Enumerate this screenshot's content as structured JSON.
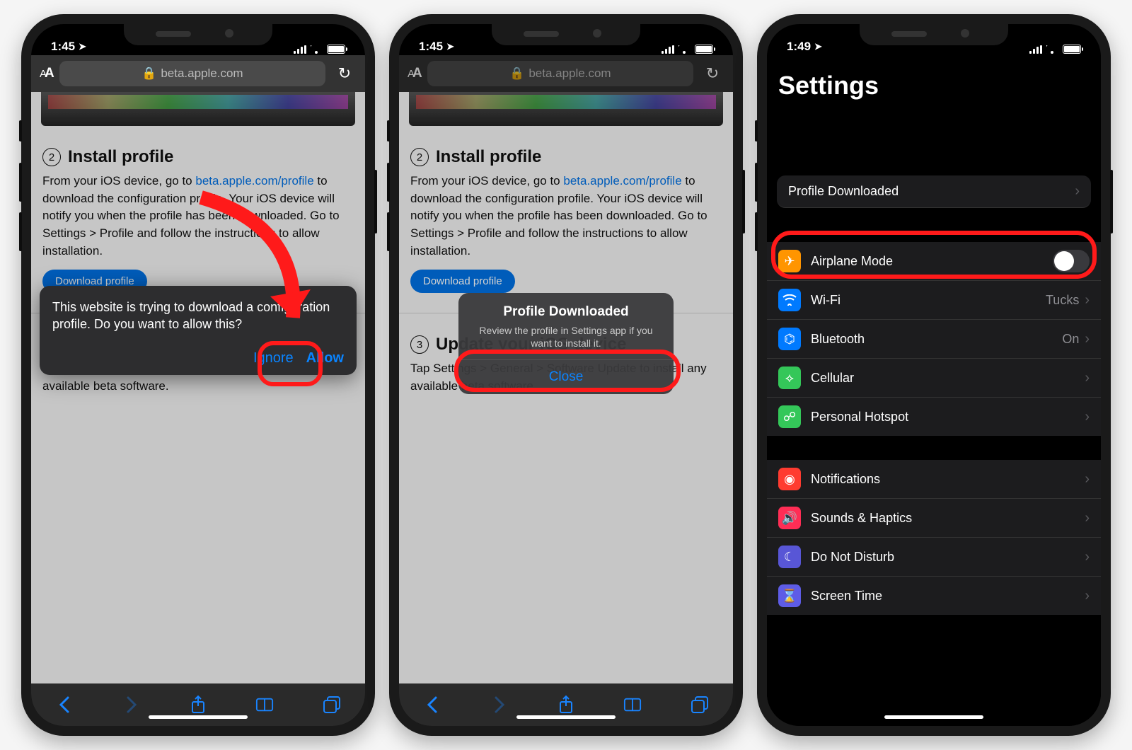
{
  "status": {
    "time12": "1:45",
    "time3": "1:49"
  },
  "safari": {
    "url_host": "beta.apple.com",
    "aa_small": "A",
    "aa_big": "A"
  },
  "page": {
    "step2_num": "2",
    "step2_title": "Install profile",
    "step2_body_pre": "From your iOS device, go to ",
    "step2_link_text": "beta.apple.com/profile",
    "step2_body_post": " to download the configuration profile. Your iOS device will notify you when the profile has been downloaded. Go to Settings > Profile and follow the instructions to allow installation.",
    "dl_btn": "Download profile",
    "step3_num": "3",
    "step3_title": "Update your iOS device",
    "step3_body": "Tap Settings > General > Software Update to install any available beta software."
  },
  "sheet": {
    "msg": "This website is trying to download a configuration profile. Do you want to allow this?",
    "ignore": "Ignore",
    "allow": "Allow"
  },
  "alert": {
    "title": "Profile Downloaded",
    "msg": "Review the profile in Settings app if you want to install it.",
    "close": "Close"
  },
  "settings": {
    "title": "Settings",
    "profile_row": "Profile Downloaded",
    "rows": {
      "airplane": "Airplane Mode",
      "wifi": "Wi-Fi",
      "wifi_val": "Tucks",
      "bt": "Bluetooth",
      "bt_val": "On",
      "cell": "Cellular",
      "hotspot": "Personal Hotspot",
      "notif": "Notifications",
      "sounds": "Sounds & Haptics",
      "dnd": "Do Not Disturb",
      "screen": "Screen Time"
    }
  }
}
